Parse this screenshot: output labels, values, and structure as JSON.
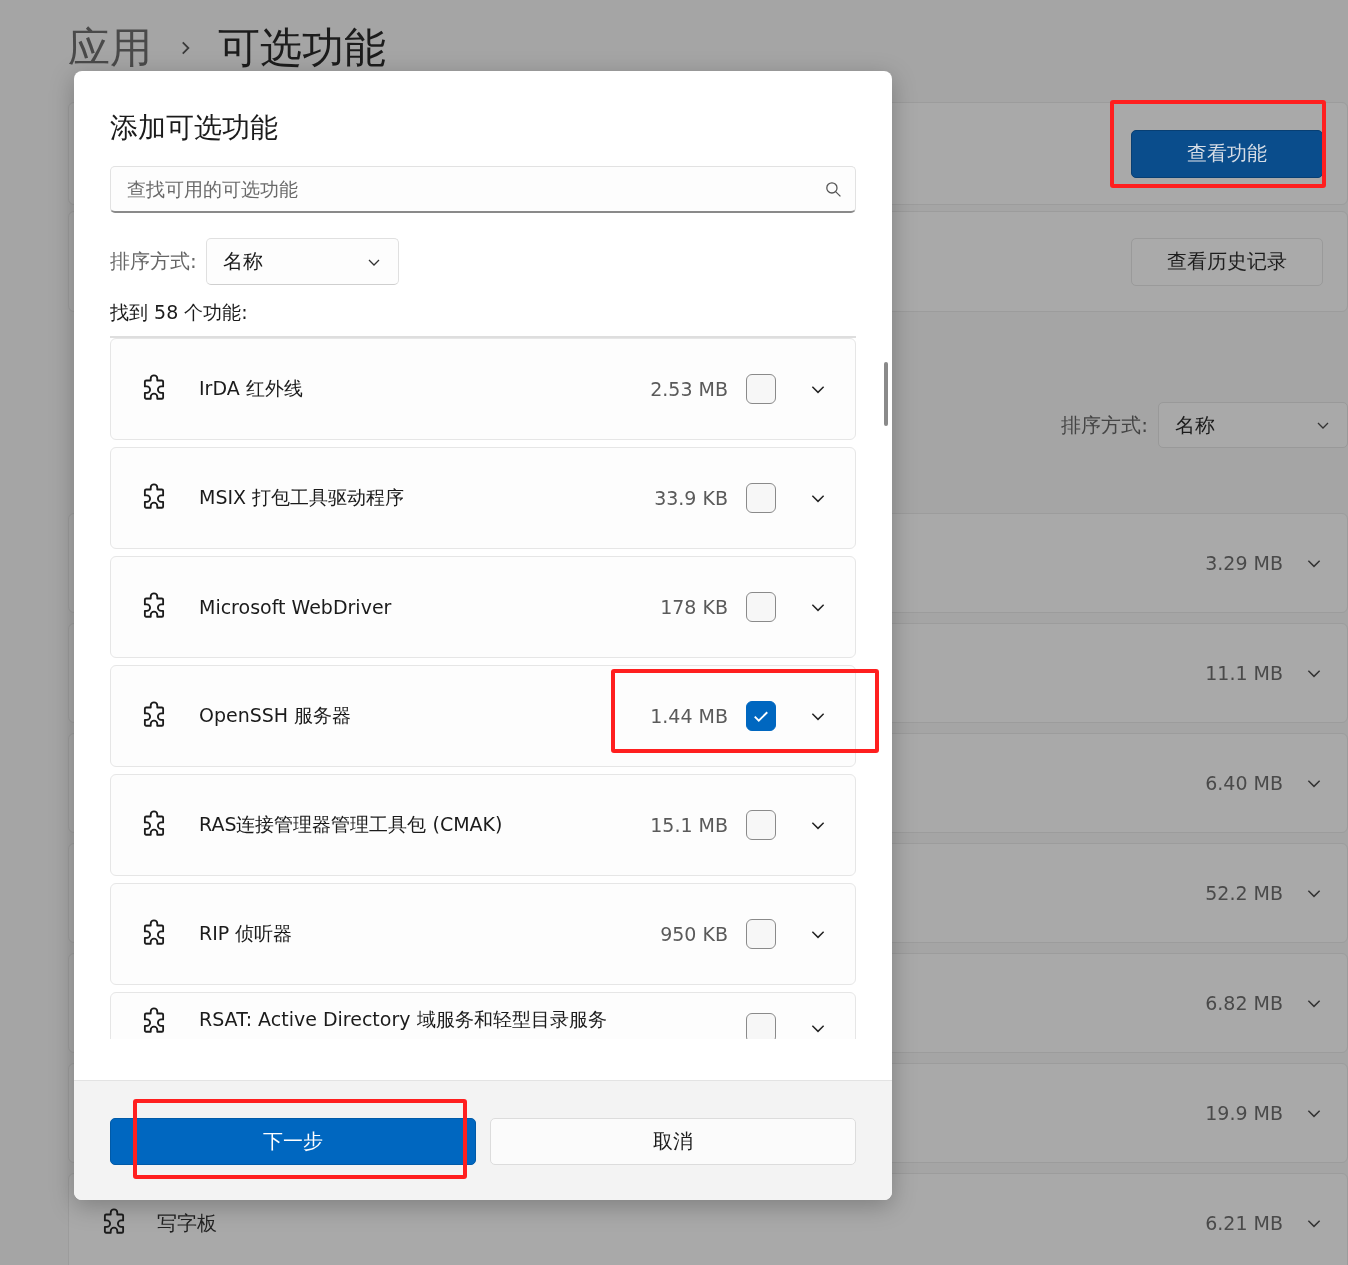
{
  "page": {
    "breadcrumb": [
      "应用",
      "可选功能"
    ],
    "cards": [
      {
        "button": {
          "label": "查看功能",
          "kind": "primary",
          "highlighted": true
        }
      },
      {
        "button": {
          "label": "查看历史记录",
          "kind": "secondary",
          "highlighted": false
        }
      }
    ],
    "sort": {
      "label": "排序方式:",
      "value": "名称"
    },
    "features": [
      {
        "size": "3.29 MB"
      },
      {
        "size": "11.1 MB"
      },
      {
        "size": "6.40 MB"
      },
      {
        "size": "52.2 MB"
      },
      {
        "size": "6.82 MB"
      },
      {
        "size": "19.9 MB"
      },
      {
        "name": "写字板",
        "size": "6.21 MB"
      }
    ]
  },
  "dialog": {
    "title": "添加可选功能",
    "search": {
      "placeholder": "查找可用的可选功能"
    },
    "sort": {
      "label": "排序方式:",
      "value": "名称"
    },
    "count": "找到 58 个功能:",
    "features": [
      {
        "name": "IrDA 红外线",
        "size": "2.53 MB",
        "checked": false,
        "highlighted": false
      },
      {
        "name": "MSIX 打包工具驱动程序",
        "size": "33.9 KB",
        "checked": false,
        "highlighted": false
      },
      {
        "name": "Microsoft WebDriver",
        "size": "178 KB",
        "checked": false,
        "highlighted": false
      },
      {
        "name": "OpenSSH 服务器",
        "size": "1.44 MB",
        "checked": true,
        "highlighted": true
      },
      {
        "name": "RAS连接管理器管理工具包 (CMAK)",
        "size": "15.1 MB",
        "checked": false,
        "highlighted": false
      },
      {
        "name": "RIP 侦听器",
        "size": "950 KB",
        "checked": false,
        "highlighted": false
      },
      {
        "name": "RSAT: Active Directory 域服务和轻型目录服务",
        "checked": false,
        "highlighted": false
      }
    ],
    "buttons": [
      {
        "label": "下一步",
        "kind": "primary",
        "highlighted": true
      },
      {
        "label": "取消",
        "kind": "secondary",
        "highlighted": false
      }
    ]
  }
}
